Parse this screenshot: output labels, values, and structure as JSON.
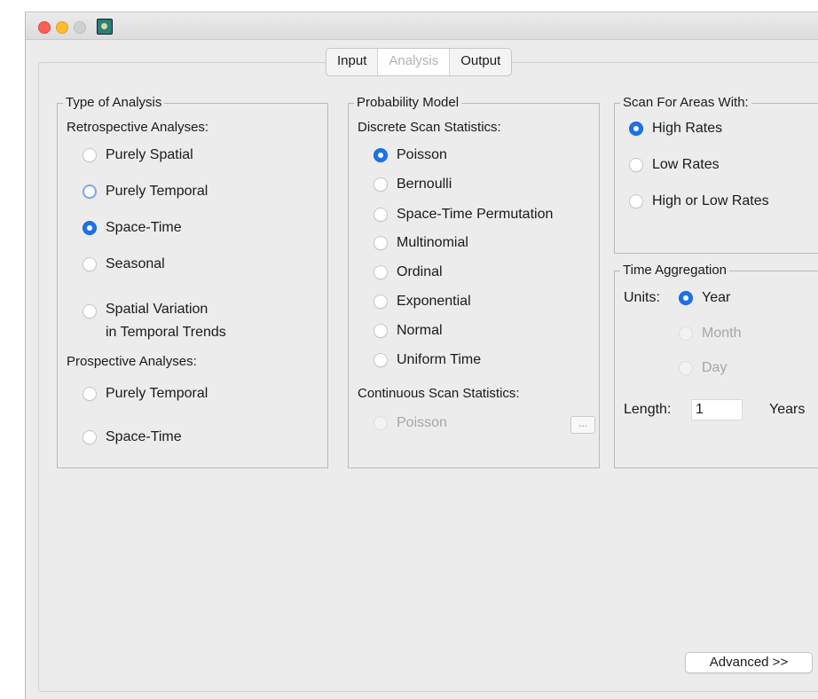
{
  "tabs": {
    "input": "Input",
    "analysis": "Analysis",
    "output": "Output"
  },
  "type_of_analysis": {
    "legend": "Type of Analysis",
    "retrospective_header": "Retrospective Analyses:",
    "purely_spatial": "Purely Spatial",
    "purely_temporal": "Purely Temporal",
    "space_time": "Space-Time",
    "seasonal": "Seasonal",
    "svtt_line1": "Spatial Variation",
    "svtt_line2": "in Temporal Trends",
    "prospective_header": "Prospective Analyses:",
    "prospective_purely_temporal": "Purely Temporal",
    "prospective_space_time": "Space-Time"
  },
  "probability_model": {
    "legend": "Probability Model",
    "discrete_header": "Discrete Scan Statistics:",
    "poisson": "Poisson",
    "bernoulli": "Bernoulli",
    "space_time_permutation": "Space-Time Permutation",
    "multinomial": "Multinomial",
    "ordinal": "Ordinal",
    "exponential": "Exponential",
    "normal": "Normal",
    "uniform_time": "Uniform Time",
    "continuous_header": "Continuous Scan Statistics:",
    "continuous_poisson": "Poisson",
    "ellipsis_button": "..."
  },
  "scan_areas": {
    "legend": "Scan For Areas With:",
    "high_rates": "High Rates",
    "low_rates": "Low Rates",
    "high_or_low": "High or Low Rates"
  },
  "time_aggregation": {
    "legend": "Time Aggregation",
    "units_label": "Units:",
    "year": "Year",
    "month": "Month",
    "day": "Day",
    "length_label": "Length:",
    "length_value": "1",
    "length_units": "Years"
  },
  "advanced_button": "Advanced >>",
  "colors": {
    "accent": "#1b73e8",
    "disabled_text": "#a6a6a6",
    "background": "#ececec"
  }
}
